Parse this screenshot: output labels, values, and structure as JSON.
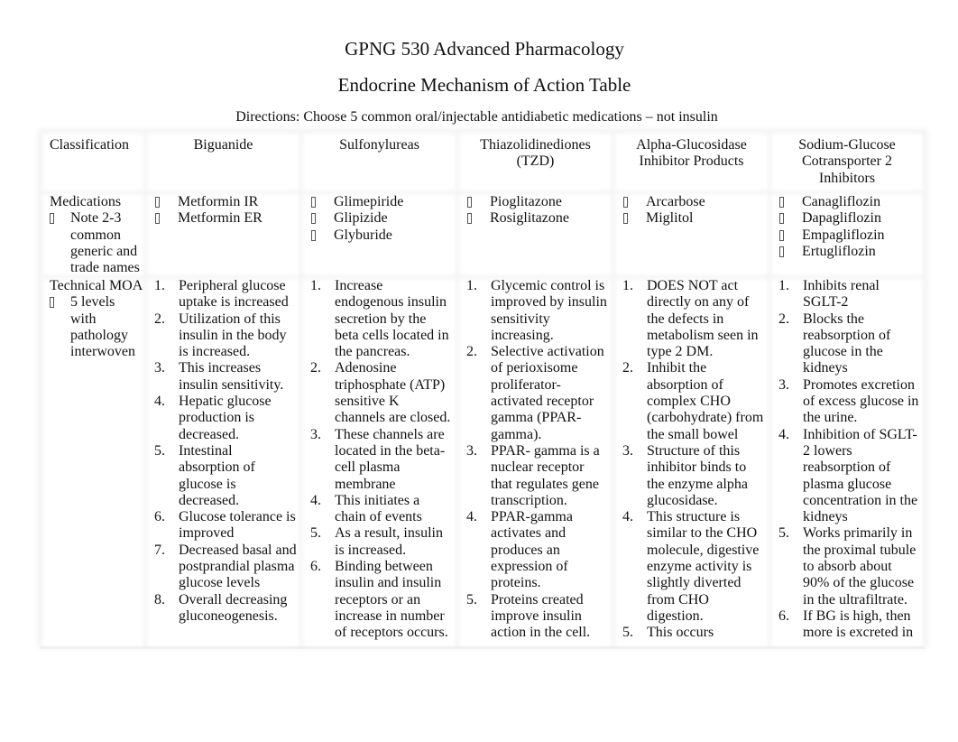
{
  "document": {
    "title": "GPNG 530 Advanced Pharmacology",
    "subtitle": "Endocrine Mechanism of Action Table",
    "directions": "Directions: Choose 5 common oral/injectable antidiabetic medications – not insulin"
  },
  "table": {
    "headers": [
      "Classification",
      "Biguanide",
      "Sulfonylureas",
      "Thiazolidinediones (TZD)",
      "Alpha-Glucosidase Inhibitor Products",
      "Sodium-Glucose Cotransporter 2 Inhibitors"
    ],
    "medications_row": {
      "label": "Medications",
      "note": "Note 2-3 common generic and trade names",
      "bullet_icon": "missing-glyph-bullet",
      "columns": [
        [
          "Metformin IR",
          "Metformin ER"
        ],
        [
          "Glimepiride",
          "Glipizide",
          "Glyburide"
        ],
        [
          "Pioglitazone",
          "Rosiglitazone"
        ],
        [
          "Arcarbose",
          "Miglitol"
        ],
        [
          "Canagliflozin",
          "Dapagliflozin",
          "Empagliflozin",
          "Ertugliflozin"
        ]
      ]
    },
    "moa_row": {
      "label": "Technical MOA",
      "note": "5 levels with pathology interwoven",
      "columns": [
        [
          "Peripheral glucose uptake is increased",
          "Utilization of this insulin in the body is increased.",
          "This increases insulin sensitivity.",
          "Hepatic glucose production is decreased.",
          "Intestinal absorption of glucose is decreased.",
          "Glucose tolerance is improved",
          "Decreased basal and postprandial plasma glucose levels",
          "Overall decreasing gluconeogenesis."
        ],
        [
          "Increase endogenous insulin secretion by the beta cells located in the pancreas.",
          "Adenosine triphosphate (ATP) sensitive K channels are closed.",
          "These channels are located in the beta-cell plasma membrane",
          "This initiates a chain of events",
          "As a result, insulin is increased.",
          "Binding between insulin and insulin receptors or an increase in number of receptors occurs."
        ],
        [
          "Glycemic control is improved by insulin sensitivity increasing.",
          "Selective activation of perioxisome proliferator-activated receptor gamma (PPAR-gamma).",
          "PPAR- gamma is a nuclear receptor that regulates gene transcription.",
          "PPAR-gamma activates and produces an expression of proteins.",
          "Proteins created improve insulin action in the cell."
        ],
        [
          "DOES NOT act directly on any of the defects in metabolism seen in type 2 DM.",
          "Inhibit the absorption of complex CHO (carbohydrate) from the small bowel",
          "Structure of this inhibitor binds to the enzyme alpha glucosidase.",
          "This structure is similar to the CHO molecule, digestive enzyme activity is slightly diverted from CHO digestion.",
          "This occurs"
        ],
        [
          "Inhibits renal SGLT-2",
          "Blocks the reabsorption of glucose in the kidneys",
          "Promotes excretion of excess glucose in the urine.",
          "Inhibition of SGLT-2 lowers reabsorption of plasma glucose concentration in the kidneys",
          "Works primarily in the proximal tubule to absorb about 90% of the glucose in the ultrafiltrate.",
          "If BG is high, then more is excreted in"
        ]
      ]
    }
  }
}
